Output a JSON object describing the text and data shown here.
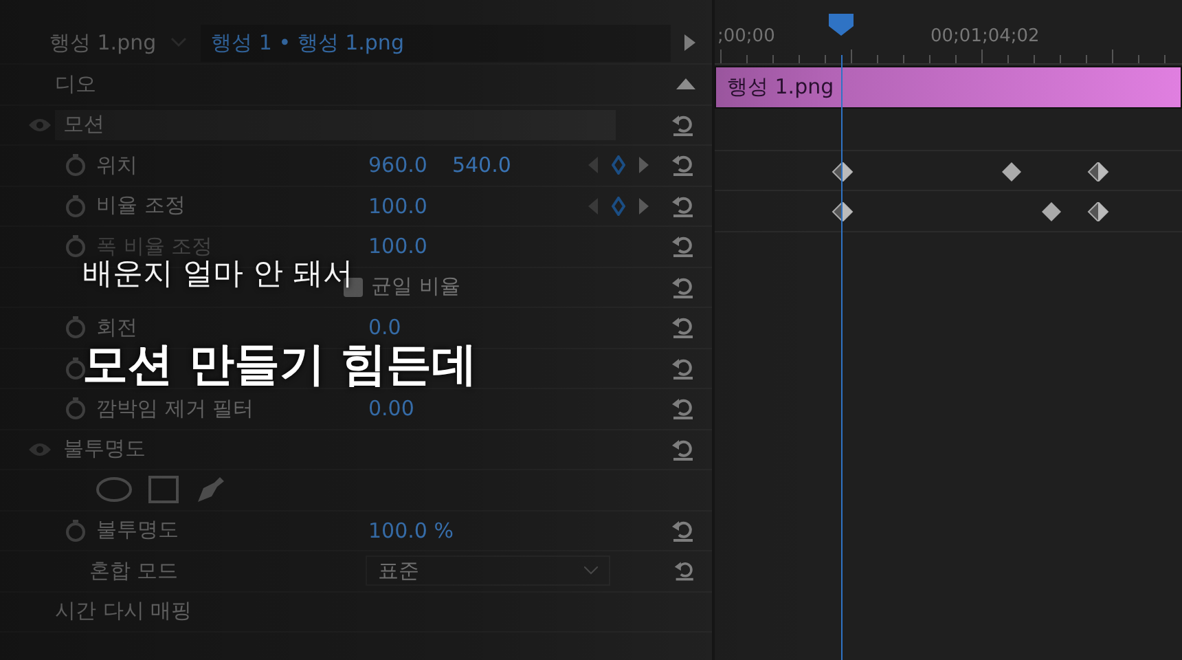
{
  "header": {
    "source_clip": "행성 1.png",
    "sequence_clip": "행성 1 • 행성 1.png"
  },
  "rows": [
    {
      "kind": "section",
      "label": "디오",
      "collapse": true
    },
    {
      "kind": "effect",
      "label": "모션",
      "highlighted": true
    },
    {
      "kind": "property",
      "label": "위치",
      "values": [
        "960.0",
        "540.0"
      ],
      "keyframes": true,
      "disabled": false
    },
    {
      "kind": "property",
      "label": "비율 조정",
      "values": [
        "100.0"
      ],
      "keyframes": true,
      "disabled": false
    },
    {
      "kind": "property",
      "label": "폭 비율 조정",
      "values": [
        "100.0"
      ],
      "keyframes": false,
      "disabled": true
    },
    {
      "kind": "checkbox",
      "label": "균일 비율",
      "checked": true
    },
    {
      "kind": "property",
      "label": "회전",
      "values": [
        "0.0"
      ],
      "keyframes": false,
      "disabled": false
    },
    {
      "kind": "covered"
    },
    {
      "kind": "property",
      "label": "깜박임 제거 필터",
      "values": [
        "0.00"
      ],
      "keyframes": false,
      "disabled": false
    },
    {
      "kind": "effect",
      "label": "불투명도",
      "highlighted": false
    },
    {
      "kind": "mask_tools"
    },
    {
      "kind": "property",
      "label": "불투명도",
      "values": [
        "100.0 %"
      ],
      "keyframes": false,
      "disabled": false
    },
    {
      "kind": "dropdown",
      "label": "혼합 모드",
      "value": "표준"
    },
    {
      "kind": "section",
      "label": "시간 다시 매핑",
      "collapse": false
    }
  ],
  "timeline": {
    "timecodes": [
      ";00;00",
      "00;01;04;02"
    ],
    "clip": "행성 1.png",
    "keyframe_rows": [
      {
        "keyframes": [
          {
            "kind": "half"
          },
          {
            "kind": "full"
          },
          {
            "kind": "half"
          }
        ]
      },
      {
        "keyframes": [
          {
            "kind": "half"
          },
          {
            "kind": "full"
          },
          {
            "kind": "half"
          }
        ]
      }
    ]
  },
  "caption": {
    "line_1": "배운지 얼마 안 돼서",
    "line_2": "모션 만들기 힘든데"
  }
}
